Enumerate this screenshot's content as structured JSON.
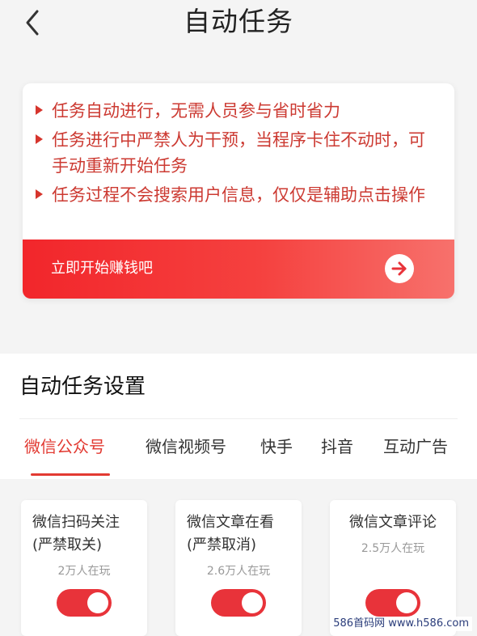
{
  "header": {
    "title": "自动任务"
  },
  "notice": {
    "tips": [
      "任务自动进行，无需人员参与省时省力",
      "任务进行中严禁人为干预，当程序卡住不动时，可手动重新开始任务",
      "任务过程不会搜索用户信息，仅仅是辅助点击操作"
    ],
    "start_label": "立即开始赚钱吧"
  },
  "settings": {
    "title": "自动任务设置",
    "tabs": [
      "微信公众号",
      "微信视频号",
      "快手",
      "抖音",
      "互动广告"
    ],
    "active_tab": "微信公众号",
    "tasks": [
      {
        "name": "微信扫码关注(严禁取关)",
        "players": "2万人在玩",
        "enabled": true
      },
      {
        "name": "微信文章在看(严禁取消)",
        "players": "2.6万人在玩",
        "enabled": true
      },
      {
        "name": "微信文章评论",
        "players": "2.5万人在玩",
        "enabled": true
      }
    ]
  },
  "colors": {
    "accent": "#e8333a",
    "tip_text": "#cc3a32"
  },
  "watermark": "586首码网 www.h586.com"
}
